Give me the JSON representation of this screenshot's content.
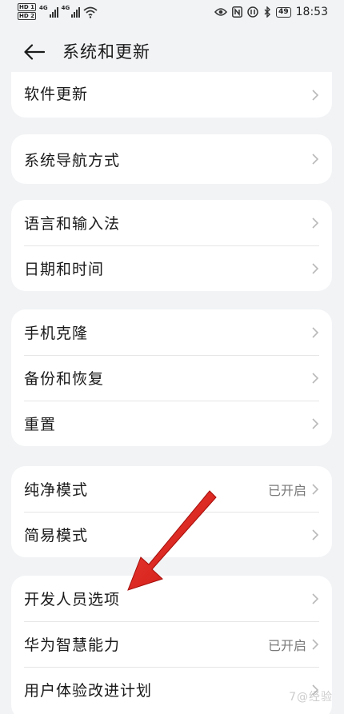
{
  "status_bar": {
    "hd1": "HD 1",
    "hd2": "HD 2",
    "net1": "4G",
    "net2": "4G",
    "time": "18:53",
    "battery": "49"
  },
  "header": {
    "title": "系统和更新"
  },
  "cards": [
    {
      "rows": [
        {
          "label": "软件更新",
          "value": ""
        }
      ]
    },
    {
      "rows": [
        {
          "label": "系统导航方式",
          "value": ""
        }
      ]
    },
    {
      "rows": [
        {
          "label": "语言和输入法",
          "value": ""
        },
        {
          "label": "日期和时间",
          "value": ""
        }
      ]
    },
    {
      "rows": [
        {
          "label": "手机克隆",
          "value": ""
        },
        {
          "label": "备份和恢复",
          "value": ""
        },
        {
          "label": "重置",
          "value": ""
        }
      ]
    },
    {
      "rows": [
        {
          "label": "纯净模式",
          "value": "已开启"
        },
        {
          "label": "简易模式",
          "value": ""
        }
      ]
    },
    {
      "rows": [
        {
          "label": "开发人员选项",
          "value": ""
        },
        {
          "label": "华为智慧能力",
          "value": "已开启"
        },
        {
          "label": "用户体验改进计划",
          "value": ""
        }
      ]
    }
  ],
  "watermark": "7@经验",
  "colors": {
    "background": "#f1f3f5",
    "card": "#ffffff",
    "annotation_arrow": "#e3201b"
  }
}
